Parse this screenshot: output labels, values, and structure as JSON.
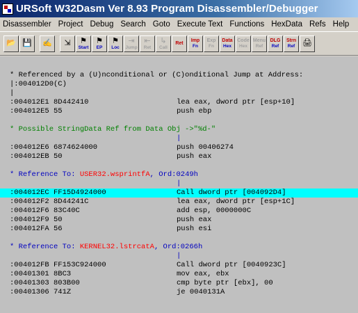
{
  "window": {
    "title": "URSoft W32Dasm Ver 8.93 Program Disassembler/Debugger"
  },
  "menu": [
    "Disassembler",
    "Project",
    "Debug",
    "Search",
    "Goto",
    "Execute Text",
    "Functions",
    "HexData",
    "Refs",
    "Help"
  ],
  "toolbar": {
    "buttons": [
      {
        "name": "open-file-icon",
        "glyph": "📂",
        "label": "",
        "disabled": false
      },
      {
        "name": "save-file-icon",
        "glyph": "💾",
        "label": "",
        "disabled": false
      },
      {
        "name": "find-text-icon",
        "glyph": "✍",
        "label": "",
        "disabled": false
      },
      {
        "name": "load-process-icon",
        "glyph": "⇲",
        "label": "",
        "disabled": false
      },
      {
        "name": "goto-start-icon",
        "glyph": "⚑",
        "label": "Start",
        "disabled": false
      },
      {
        "name": "goto-ep-icon",
        "glyph": "⚑",
        "label": "EP",
        "disabled": false
      },
      {
        "name": "goto-loc-icon",
        "glyph": "⚑",
        "label": "Loc",
        "disabled": false
      },
      {
        "name": "jump-to-icon",
        "glyph": "⇥",
        "label": "Jump",
        "disabled": true
      },
      {
        "name": "return-from-icon",
        "glyph": "⇤",
        "label": "Ret",
        "disabled": true
      },
      {
        "name": "call-icon",
        "glyph": "↳",
        "label": "Call",
        "disabled": true
      },
      {
        "name": "ret-icon",
        "glyph": "Ret",
        "label": "",
        "disabled": false
      },
      {
        "name": "imp-fn-icon",
        "glyph": "Imp",
        "label": "Fn",
        "disabled": false
      },
      {
        "name": "exp-fn-icon",
        "glyph": "Exp",
        "label": "Fn",
        "disabled": true
      },
      {
        "name": "data-hex-icon",
        "glyph": "Data",
        "label": "Hex",
        "disabled": false
      },
      {
        "name": "code-hex-icon",
        "glyph": "Code",
        "label": "Hex",
        "disabled": true
      },
      {
        "name": "menu-ref-icon",
        "glyph": "Menu",
        "label": "Ref",
        "disabled": true
      },
      {
        "name": "dlg-ref-icon",
        "glyph": "DLG",
        "label": "Ref",
        "disabled": false
      },
      {
        "name": "strn-ref-icon",
        "glyph": "Strn",
        "label": "Ref",
        "disabled": false
      },
      {
        "name": "print-icon",
        "glyph": "🖨",
        "label": "",
        "disabled": false
      }
    ]
  },
  "listing": [
    {
      "type": "blank"
    },
    {
      "type": "text",
      "text": "* Referenced by a (U)nconditional or (C)onditional Jump at Address:"
    },
    {
      "type": "text",
      "text": "|:004012D0(C)"
    },
    {
      "type": "text",
      "text": "|"
    },
    {
      "type": "code",
      "addr": ":004012E1 8D442410",
      "instr": "lea eax, dword ptr [esp+10]"
    },
    {
      "type": "code",
      "addr": ":004012E5 55",
      "instr": "push ebp"
    },
    {
      "type": "blank"
    },
    {
      "type": "green",
      "text": "* Possible StringData Ref from Data Obj ->\"%d-\""
    },
    {
      "type": "bar",
      "text": "|"
    },
    {
      "type": "code",
      "addr": ":004012E6 6874624000",
      "instr": "push 00406274"
    },
    {
      "type": "code",
      "addr": ":004012EB 50",
      "instr": "push eax"
    },
    {
      "type": "blank"
    },
    {
      "type": "ref",
      "prefix": "* Reference To: ",
      "func": "USER32.wsprintfA",
      "suffix": ", Ord:0249h"
    },
    {
      "type": "bar",
      "text": "|"
    },
    {
      "type": "code",
      "addr": ":004012EC FF15D4924000",
      "instr": "Call dword ptr [004092D4]",
      "highlight": true
    },
    {
      "type": "code",
      "addr": ":004012F2 8D44241C",
      "instr": "lea eax, dword ptr [esp+1C]"
    },
    {
      "type": "code",
      "addr": ":004012F6 83C40C",
      "instr": "add esp, 0000000C"
    },
    {
      "type": "code",
      "addr": ":004012F9 50",
      "instr": "push eax"
    },
    {
      "type": "code",
      "addr": ":004012FA 56",
      "instr": "push esi"
    },
    {
      "type": "blank"
    },
    {
      "type": "ref",
      "prefix": "* Reference To: ",
      "func": "KERNEL32.lstrcatA",
      "suffix": ", Ord:0266h"
    },
    {
      "type": "bar",
      "text": "|"
    },
    {
      "type": "code",
      "addr": ":004012FB FF153C924000",
      "instr": "Call dword ptr [0040923C]"
    },
    {
      "type": "code",
      "addr": ":00401301 8BC3",
      "instr": "mov eax, ebx"
    },
    {
      "type": "code",
      "addr": ":00401303 803B00",
      "instr": "cmp byte ptr [ebx], 00"
    },
    {
      "type": "code",
      "addr": ":00401306 741Z",
      "instr": "je 0040131A"
    }
  ],
  "colors": {
    "highlight": "#00ffff",
    "string_ref": "#008000",
    "reference": "#0000c0",
    "function_name": "#ff0000"
  }
}
